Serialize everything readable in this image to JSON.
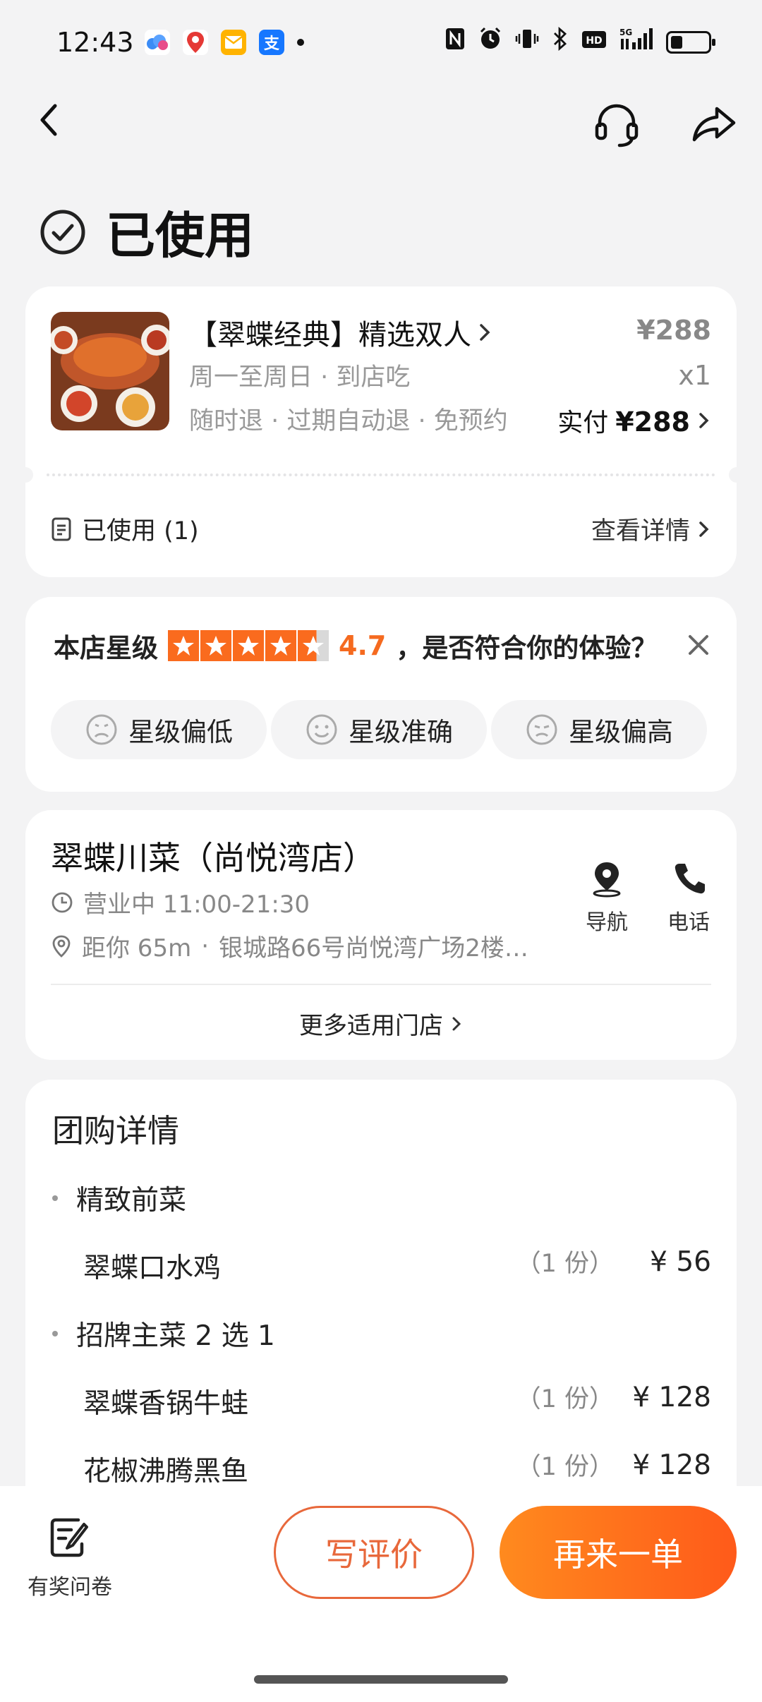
{
  "status_bar": {
    "time": "12:43",
    "apps": [
      "cloud-app-icon",
      "map-pin-app-icon",
      "mail-app-icon",
      "alipay-app-icon"
    ],
    "network": "5G"
  },
  "page": {
    "title": "已使用"
  },
  "order": {
    "name": "【翠蝶经典】精选双人",
    "schedule": "周一至周日 · 到店吃",
    "policy": "随时退 · 过期自动退 · 免预约",
    "price": "¥288",
    "quantity": "x1",
    "paid_label": "实付",
    "paid_amount": "¥288",
    "used_label": "已使用 (1)",
    "details_link": "查看详情"
  },
  "rating": {
    "label": "本店星级",
    "score": "4.7",
    "star_fraction": 0.94,
    "question": "，是否符合你的体验？",
    "options": [
      "星级偏低",
      "星级准确",
      "星级偏高"
    ]
  },
  "store": {
    "name": "翠蝶川菜（尚悦湾店）",
    "hours": "营业中 11:00-21:30",
    "distance": "距你 65m",
    "address": "银城路66号尚悦湾广场2楼…",
    "nav_label": "导航",
    "call_label": "电话",
    "more_stores": "更多适用门店"
  },
  "package": {
    "title": "团购详情",
    "sections": [
      {
        "name": "精致前菜",
        "items": [
          {
            "name": "翠蝶口水鸡",
            "count": "（1 份）",
            "price": "¥ 56"
          }
        ]
      },
      {
        "name": "招牌主菜 2 选 1",
        "items": [
          {
            "name": "翠蝶香锅牛蛙",
            "count": "（1 份）",
            "price": "¥ 128"
          },
          {
            "name": "花椒沸腾黑鱼",
            "count": "（1 份）",
            "price": "¥ 128"
          }
        ]
      }
    ]
  },
  "bottom": {
    "survey_label": "有奖问卷",
    "review_label": "写评价",
    "reorder_label": "再来一单"
  },
  "colors": {
    "accent": "#ff6a1e",
    "review_border": "#e8683b",
    "star": "#fa6b1e"
  }
}
